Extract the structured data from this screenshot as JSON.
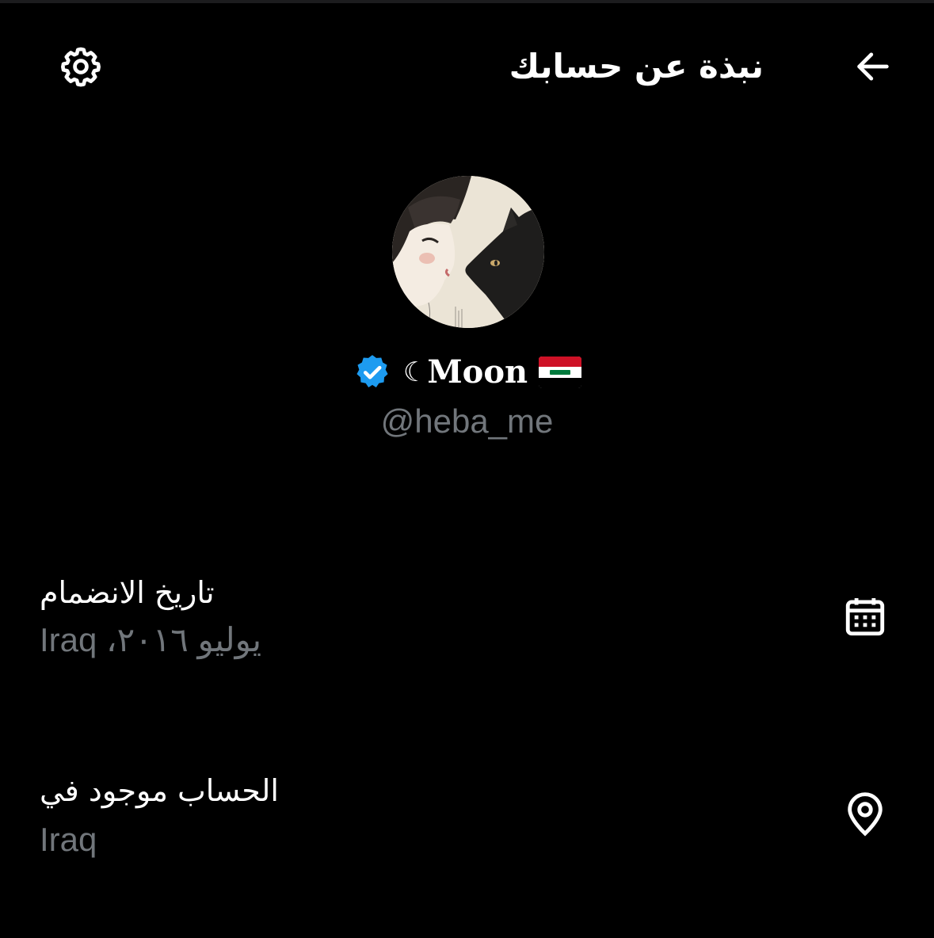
{
  "header": {
    "title": "نبذة عن حسابك",
    "back_icon": "arrow-left-icon",
    "settings_icon": "gear-icon"
  },
  "profile": {
    "display_name": "Moon",
    "moon_glyph": "☾",
    "flag_icon": "iraq-flag-icon",
    "verified_icon": "verified-badge-icon",
    "handle": "@heba_me",
    "verified_color": "#1d9bf0"
  },
  "joined": {
    "label": "تاريخ الانضمام",
    "value": "Iraq ،يوليو ٢٠١٦",
    "icon": "calendar-icon"
  },
  "location": {
    "label": "الحساب موجود في",
    "value": "Iraq",
    "icon": "location-pin-icon"
  },
  "colors": {
    "background": "#000000",
    "primary_text": "#ffffff",
    "secondary_text": "#71767b"
  }
}
